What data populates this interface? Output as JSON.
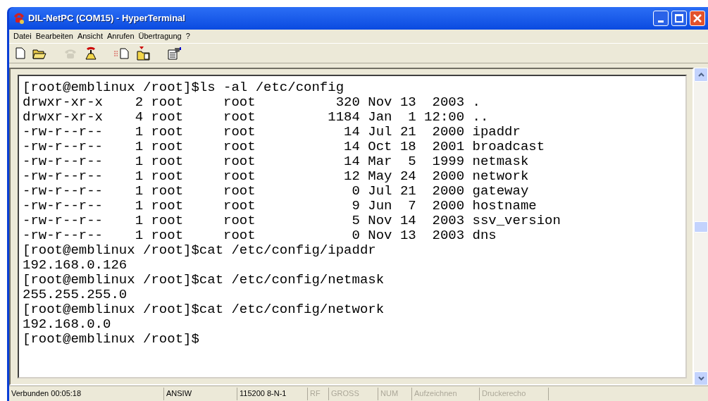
{
  "window": {
    "title": "DIL-NetPC (COM15) - HyperTerminal"
  },
  "menu": [
    "Datei",
    "Bearbeiten",
    "Ansicht",
    "Anrufen",
    "Übertragung",
    "?"
  ],
  "toolbar": [
    {
      "kind": "new",
      "disabled": false
    },
    {
      "kind": "open",
      "disabled": false
    },
    {
      "kind": "call",
      "disabled": true
    },
    {
      "kind": "hangup",
      "disabled": false
    },
    {
      "kind": "send",
      "disabled": false
    },
    {
      "kind": "receive",
      "disabled": false
    },
    {
      "kind": "properties",
      "disabled": false
    }
  ],
  "terminal": {
    "lines": [
      "[root@emblinux /root]$ls -al /etc/config",
      "drwxr-xr-x    2 root     root          320 Nov 13  2003 .",
      "drwxr-xr-x    4 root     root         1184 Jan  1 12:00 ..",
      "-rw-r--r--    1 root     root           14 Jul 21  2000 ipaddr",
      "-rw-r--r--    1 root     root           14 Oct 18  2001 broadcast",
      "-rw-r--r--    1 root     root           14 Mar  5  1999 netmask",
      "-rw-r--r--    1 root     root           12 May 24  2000 network",
      "-rw-r--r--    1 root     root            0 Jul 21  2000 gateway",
      "-rw-r--r--    1 root     root            9 Jun  7  2000 hostname",
      "-rw-r--r--    1 root     root            5 Nov 14  2003 ssv_version",
      "-rw-r--r--    1 root     root            0 Nov 13  2003 dns",
      "[root@emblinux /root]$cat /etc/config/ipaddr",
      "192.168.0.126",
      "[root@emblinux /root]$cat /etc/config/netmask",
      "255.255.255.0",
      "[root@emblinux /root]$cat /etc/config/network",
      "192.168.0.0",
      "[root@emblinux /root]$"
    ]
  },
  "status_bar": [
    {
      "text": "Verbunden 00:05:18",
      "disabled": false
    },
    {
      "text": "ANSIW",
      "disabled": false
    },
    {
      "text": "115200 8-N-1",
      "disabled": false
    },
    {
      "text": "RF",
      "disabled": true
    },
    {
      "text": "GROSS",
      "disabled": true
    },
    {
      "text": "NUM",
      "disabled": true
    },
    {
      "text": "Aufzeichnen",
      "disabled": true
    },
    {
      "text": "Druckerecho",
      "disabled": true
    }
  ]
}
